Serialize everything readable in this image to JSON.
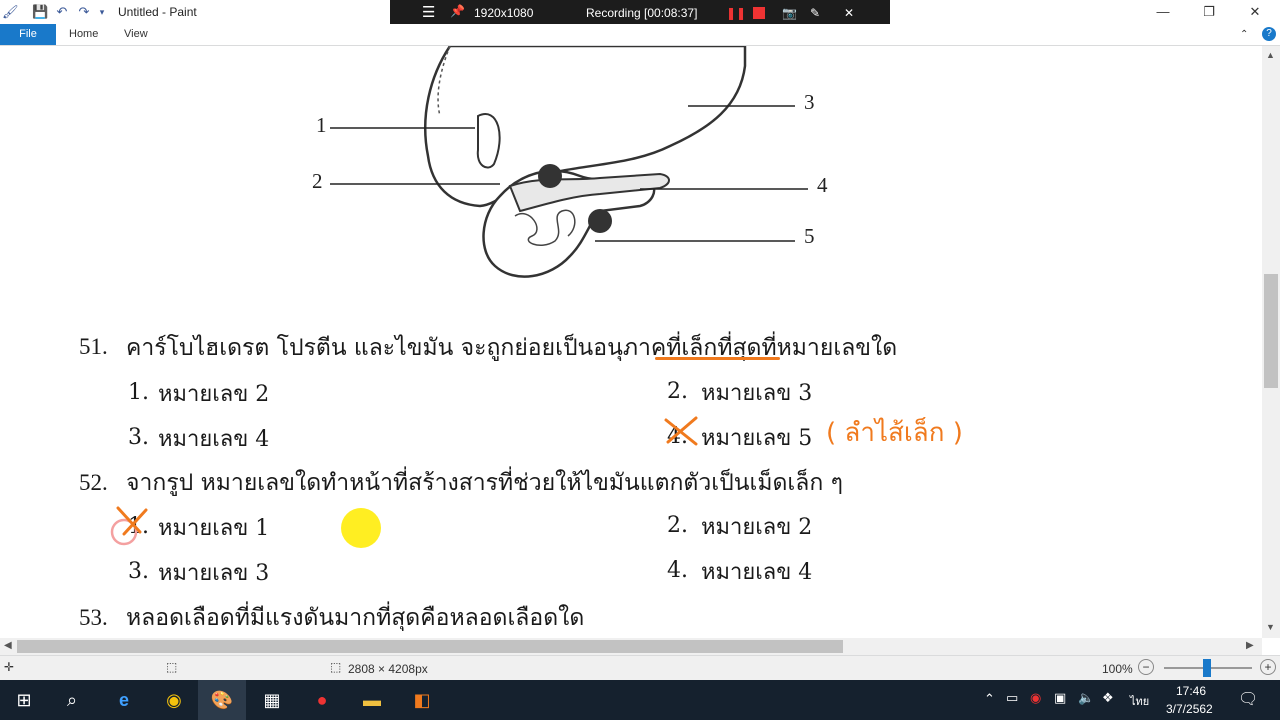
{
  "window": {
    "title": "Untitled - Paint",
    "minimize": "—",
    "maximize": "❐",
    "close": "✕"
  },
  "recorder": {
    "resolution": "1920x1080",
    "status": "Recording [00:08:37]"
  },
  "ribbon": {
    "tabs": [
      "File",
      "Home",
      "View"
    ]
  },
  "diagram": {
    "labels": [
      "1",
      "2",
      "3",
      "4",
      "5"
    ]
  },
  "questions": [
    {
      "number": "51.",
      "text": "คาร์โบไฮเดรต โปรตีน และไขมัน จะถูกย่อยเป็นอนุภาคที่เล็กที่สุดที่หมายเลขใด",
      "options": [
        {
          "num": "1.",
          "label": "หมายเลข 2"
        },
        {
          "num": "2.",
          "label": "หมายเลข 3"
        },
        {
          "num": "3.",
          "label": "หมายเลข 4"
        },
        {
          "num": "4.",
          "label": "หมายเลข 5"
        }
      ],
      "annotation": "( ลำไส้เล็ก )"
    },
    {
      "number": "52.",
      "text": "จากรูป หมายเลขใดทำหน้าที่สร้างสารที่ช่วยให้ไขมันแตกตัวเป็นเม็ดเล็ก ๆ",
      "options": [
        {
          "num": "1.",
          "label": "หมายเลข 1"
        },
        {
          "num": "2.",
          "label": "หมายเลข 2"
        },
        {
          "num": "3.",
          "label": "หมายเลข 3"
        },
        {
          "num": "4.",
          "label": "หมายเลข 4"
        }
      ]
    },
    {
      "number": "53.",
      "text": "หลอดเลือดที่มีแรงดันมากที่สุดคือหลอดเลือดใด"
    }
  ],
  "status": {
    "image_size": "2808 × 4208px",
    "zoom": "100%"
  },
  "taskbar": {
    "time": "17:46",
    "date": "3/7/2562",
    "language": "ไทย"
  },
  "colors": {
    "annotation": "#f07a1e",
    "file_tab": "#1979ca",
    "recording_bar": "#1c1c1c",
    "taskbar": "#15212e"
  }
}
